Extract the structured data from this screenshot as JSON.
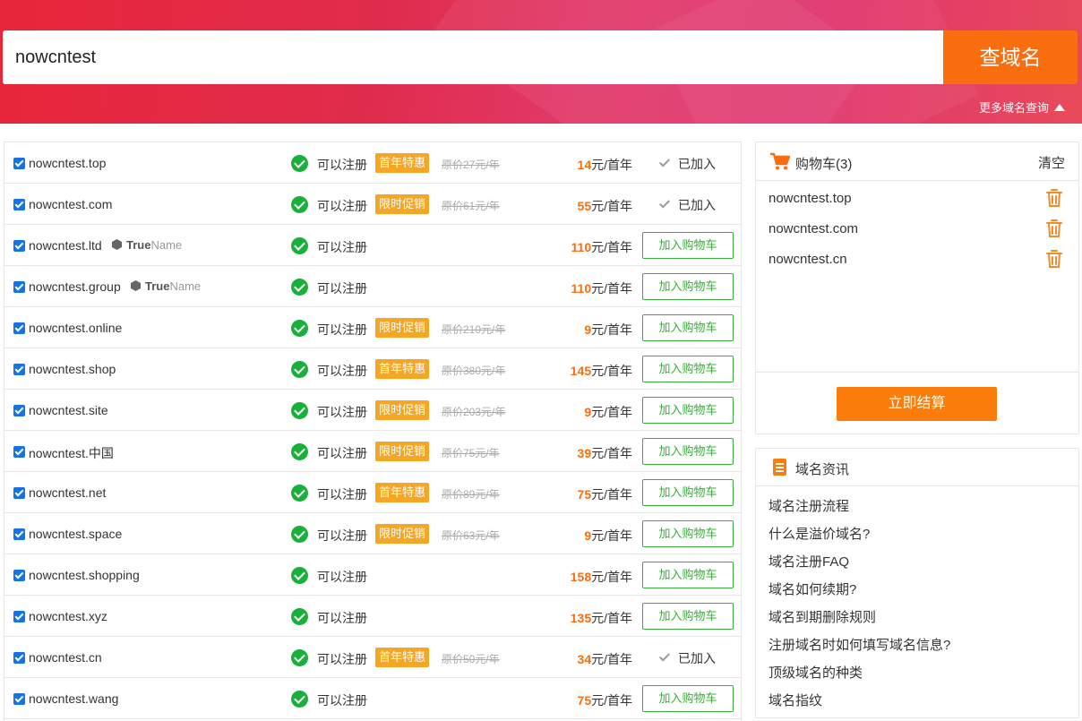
{
  "search": {
    "value": "nowcntest",
    "button": "查域名",
    "more": "更多域名查询"
  },
  "domains": [
    {
      "name": "nowcntest.top",
      "status": "可以注册",
      "promo": "首年特惠",
      "orig": "原价27元/年",
      "price": "14",
      "unit": "元/首年",
      "action": "已加入",
      "added": true
    },
    {
      "name": "nowcntest.com",
      "status": "可以注册",
      "promo": "限时促销",
      "orig": "原价61元/年",
      "price": "55",
      "unit": "元/首年",
      "action": "已加入",
      "added": true
    },
    {
      "name": "nowcntest.ltd",
      "status": "可以注册",
      "truename": true,
      "price": "110",
      "unit": "元/首年",
      "action": "加入购物车"
    },
    {
      "name": "nowcntest.group",
      "status": "可以注册",
      "truename": true,
      "price": "110",
      "unit": "元/首年",
      "action": "加入购物车"
    },
    {
      "name": "nowcntest.online",
      "status": "可以注册",
      "promo": "限时促销",
      "orig": "原价210元/年",
      "price": "9",
      "unit": "元/首年",
      "action": "加入购物车"
    },
    {
      "name": "nowcntest.shop",
      "status": "可以注册",
      "promo": "首年特惠",
      "orig": "原价380元/年",
      "price": "145",
      "unit": "元/首年",
      "action": "加入购物车"
    },
    {
      "name": "nowcntest.site",
      "status": "可以注册",
      "promo": "限时促销",
      "orig": "原价203元/年",
      "price": "9",
      "unit": "元/首年",
      "action": "加入购物车"
    },
    {
      "name": "nowcntest.中国",
      "status": "可以注册",
      "promo": "限时促销",
      "orig": "原价75元/年",
      "price": "39",
      "unit": "元/首年",
      "action": "加入购物车"
    },
    {
      "name": "nowcntest.net",
      "status": "可以注册",
      "promo": "首年特惠",
      "orig": "原价89元/年",
      "price": "75",
      "unit": "元/首年",
      "action": "加入购物车"
    },
    {
      "name": "nowcntest.space",
      "status": "可以注册",
      "promo": "限时促销",
      "orig": "原价63元/年",
      "price": "9",
      "unit": "元/首年",
      "action": "加入购物车"
    },
    {
      "name": "nowcntest.shopping",
      "status": "可以注册",
      "price": "158",
      "unit": "元/首年",
      "action": "加入购物车"
    },
    {
      "name": "nowcntest.xyz",
      "status": "可以注册",
      "price": "135",
      "unit": "元/首年",
      "action": "加入购物车"
    },
    {
      "name": "nowcntest.cn",
      "status": "可以注册",
      "promo": "首年特惠",
      "orig": "原价50元/年",
      "price": "34",
      "unit": "元/首年",
      "action": "已加入",
      "added": true
    },
    {
      "name": "nowcntest.wang",
      "status": "可以注册",
      "price": "75",
      "unit": "元/首年",
      "action": "加入购物车"
    }
  ],
  "truename": {
    "a": "True",
    "b": "Name"
  },
  "cart": {
    "title": "购物车(3)",
    "clear": "清空",
    "items": [
      "nowcntest.top",
      "nowcntest.com",
      "nowcntest.cn"
    ],
    "checkout": "立即结算"
  },
  "news": {
    "title": "域名资讯",
    "links": [
      "域名注册流程",
      "什么是溢价域名?",
      "域名注册FAQ",
      "域名如何续期?",
      "域名到期删除规则",
      "注册域名时如何填写域名信息?",
      "顶级域名的种类",
      "域名指纹"
    ]
  },
  "colors": {
    "accent": "#fa6e0f",
    "green": "#3aae3a",
    "promo": "#f5a623",
    "checkbox": "#1673e5"
  }
}
